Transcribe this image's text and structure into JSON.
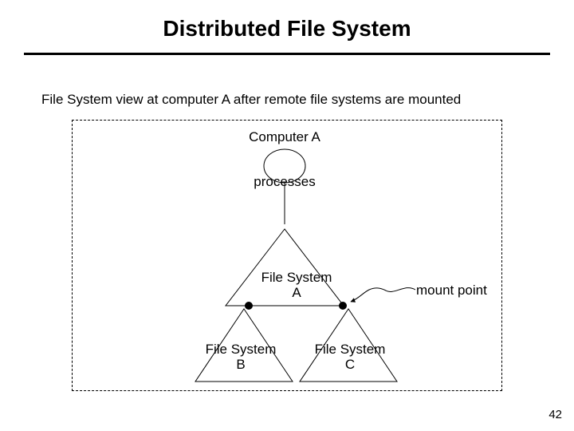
{
  "title": "Distributed File System",
  "subtitle": "File System view at computer A after remote file systems are mounted",
  "labels": {
    "computerA": "Computer A",
    "processes": "processes",
    "fsA": "File System A",
    "fsB": "File System B",
    "fsC": "File System C",
    "mount": "mount point"
  },
  "page": "42"
}
